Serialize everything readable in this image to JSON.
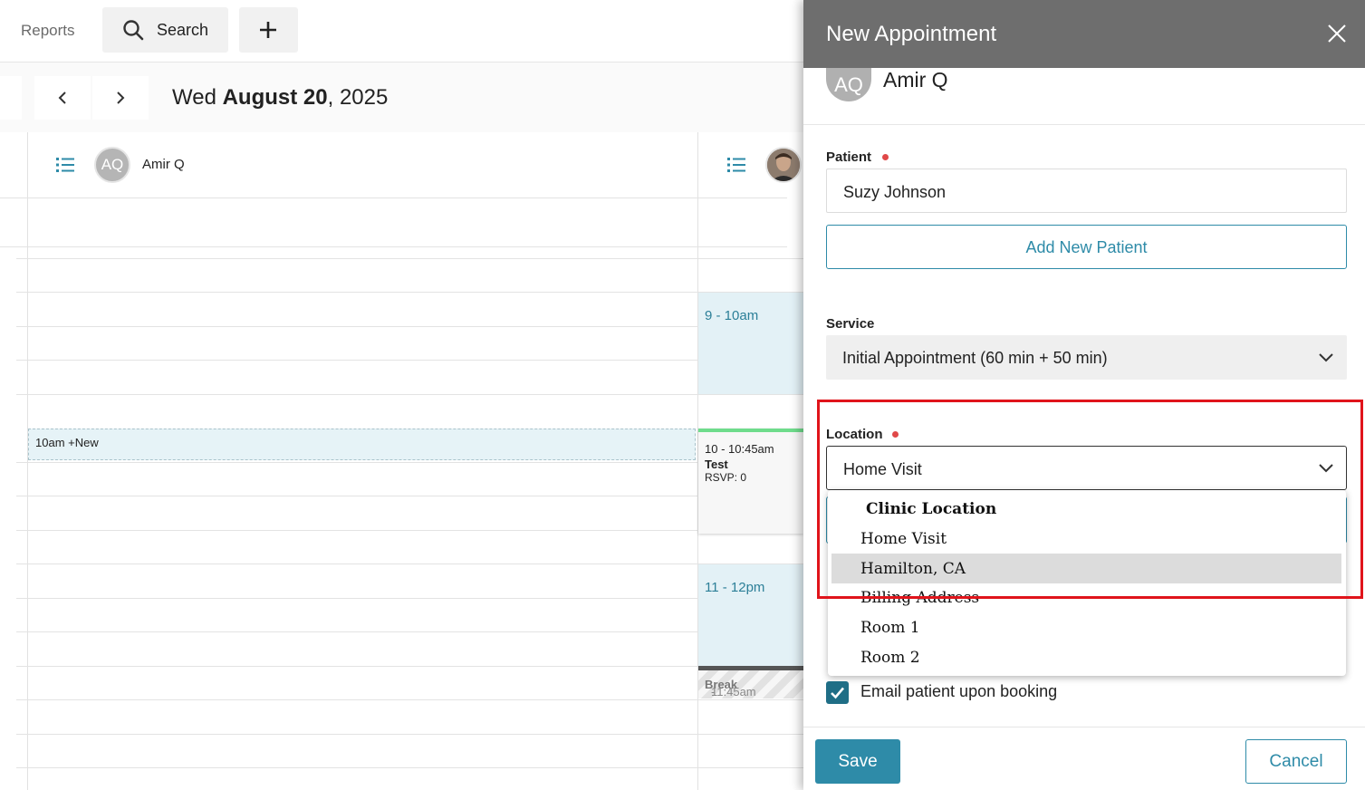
{
  "topbar": {
    "reports_label": "Reports",
    "search_label": "Search"
  },
  "date_nav": {
    "weekday": "Wed",
    "month_day": "August 20",
    "year": "2025"
  },
  "calendar": {
    "provider1": {
      "initials": "AQ",
      "name": "Amir Q"
    },
    "new_slot_label": "10am +New",
    "appointments": [
      {
        "time": "9 - 10am"
      },
      {
        "time": "11 - 12pm"
      }
    ],
    "test_event": {
      "time": "10 - 10:45am",
      "title": "Test",
      "rsvp": "RSVP: 0"
    },
    "break_event": {
      "time": "11:45am",
      "sep": " - ",
      "title": "Break"
    }
  },
  "panel": {
    "title": "New Appointment",
    "provider": {
      "initials": "AQ",
      "name": "Amir Q"
    },
    "patient": {
      "label": "Patient",
      "value": "Suzy Johnson"
    },
    "add_new_patient_label": "Add New Patient",
    "service": {
      "label": "Service",
      "value": "Initial Appointment (60 min + 50 min)"
    },
    "location": {
      "label": "Location",
      "value": "Home Visit",
      "group_label": "Clinic Location",
      "options": [
        "Home Visit",
        "Hamilton, CA",
        "Billing Address",
        "Room 1",
        "Room 2"
      ],
      "highlighted_option": "Hamilton, CA"
    },
    "email_checkbox_label": "Email patient upon booking",
    "save_label": "Save",
    "cancel_label": "Cancel"
  },
  "colors": {
    "accent": "#2e8ba8",
    "header_gray": "#6e6e6e",
    "required_dot": "#e04848",
    "annotation_red": "#e0141b"
  }
}
